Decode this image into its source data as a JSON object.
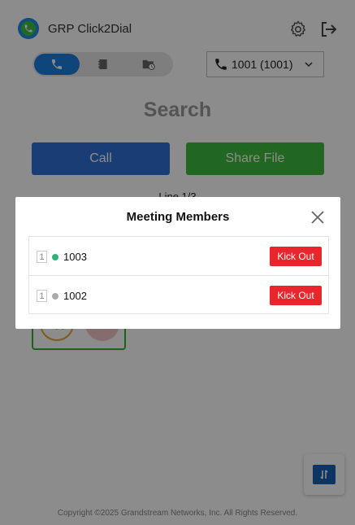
{
  "app": {
    "title": "GRP Click2Dial",
    "tabs": [
      {
        "name": "phone",
        "icon": "phone-icon",
        "active": true
      },
      {
        "name": "contacts",
        "icon": "contacts-book-icon",
        "active": false
      },
      {
        "name": "recents",
        "icon": "folder-clock-icon",
        "active": false
      }
    ],
    "line_select": {
      "value": "1001 (1001)",
      "icon": "phone-line-icon"
    },
    "search_placeholder": "Search",
    "call_button": "Call",
    "share_file_button": "Share File",
    "line_info": "Line 1/3",
    "copyright": "Copyright ©2025 Grandstream Networks, Inc. All Rights Reserved.",
    "colors": {
      "accent": "#1a7ee0",
      "call": "#2e6fd6",
      "share": "#3cba3c",
      "kick": "#e8262c"
    }
  },
  "modal": {
    "title": "Meeting Members",
    "members": [
      {
        "index": "1",
        "name": "1003",
        "status_color": "#2bb673",
        "action": "Kick Out"
      },
      {
        "index": "1",
        "name": "1002",
        "status_color": "#aaaaaa",
        "action": "Kick Out"
      }
    ]
  }
}
